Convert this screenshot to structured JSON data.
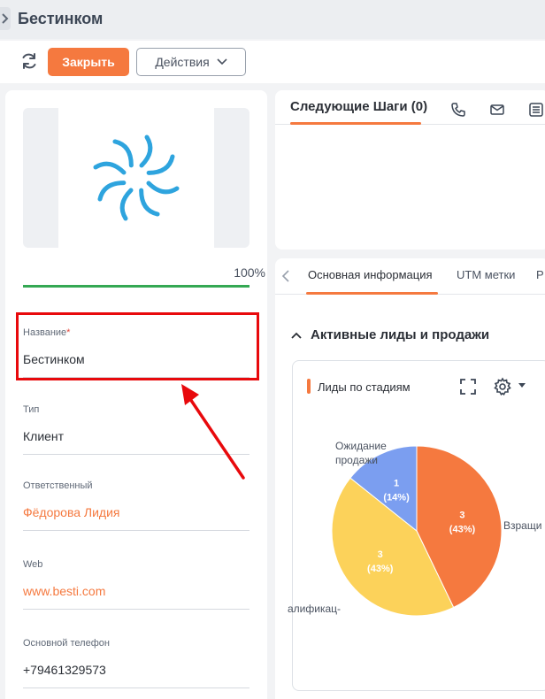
{
  "header": {
    "title": "Бестинком"
  },
  "toolbar": {
    "close_label": "Закрыть",
    "actions_label": "Действия"
  },
  "profile": {
    "completion": "100%",
    "completion_fraction": 1.0
  },
  "fields": {
    "name": {
      "label": "Название",
      "required_mark": "*",
      "value": "Бестинком"
    },
    "type": {
      "label": "Тип",
      "value": "Клиент"
    },
    "owner": {
      "label": "Ответственный",
      "value": "Фёдорова Лидия"
    },
    "web": {
      "label": "Web",
      "value": "www.besti.com"
    },
    "phone": {
      "label": "Основной телефон",
      "value": "+79461329573"
    }
  },
  "next_steps": {
    "tab_label": "Следующие Шаги (0)",
    "icons": [
      "phone-icon",
      "mail-icon",
      "list-icon"
    ]
  },
  "info_tabs": {
    "items": [
      "Основная информация",
      "UTM метки",
      "Р"
    ],
    "active": 0
  },
  "section": {
    "title": "Активные лиды и продажи"
  },
  "widget": {
    "title": "Лиды по стадиям"
  },
  "colors": {
    "accent": "#f5793f",
    "required": "#e2483d",
    "progress": "#34a853",
    "highlight": "#e8090c"
  },
  "chart_data": {
    "type": "pie",
    "title": "Лиды по стадиям",
    "slices": [
      {
        "label": "Взращи",
        "value": 3,
        "text": "3",
        "pct": "(43%)",
        "color": "#f5793f"
      },
      {
        "label": "алификац-",
        "value": 3,
        "text": "3",
        "pct": "(43%)",
        "color": "#fcd25a"
      },
      {
        "label": "Ожидание продажи",
        "value": 1,
        "text": "1",
        "pct": "(14%)",
        "color": "#7b9ef0"
      }
    ]
  }
}
